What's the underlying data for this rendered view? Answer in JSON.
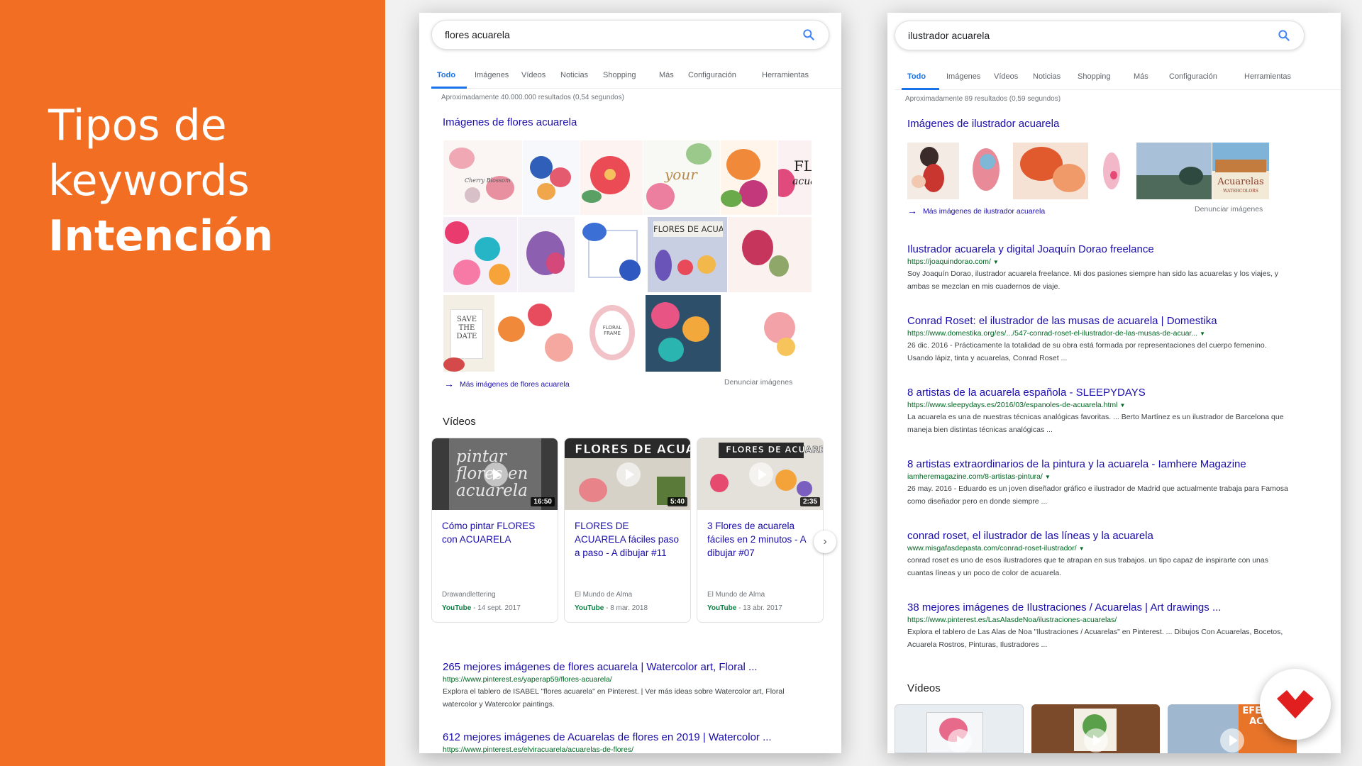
{
  "slide": {
    "title_line1": "Tipos de",
    "title_line2": "keywords",
    "title_line3": "Intención",
    "accent_color": "#f26e22"
  },
  "left_serp": {
    "query": "flores acuarela",
    "tabs": [
      "Todo",
      "Imágenes",
      "Vídeos",
      "Noticias",
      "Shopping",
      "Más",
      "Configuración",
      "Herramientas"
    ],
    "stats": "Aproximadamente 40.000.000 resultados (0,54 segundos)",
    "images_title": "Imágenes de flores acuarela",
    "image_texts": [
      "Cherry Blossom",
      "your",
      "FLO",
      "acuarela",
      "FLORES DE ACUARE",
      "SAVE THE DATE",
      "FLORAL FRAME"
    ],
    "more_images": "Más imágenes de flores acuarela",
    "report_images": "Denunciar imágenes",
    "videos_heading": "Vídeos",
    "videos": [
      {
        "title": "Cómo pintar FLORES con ACUARELA",
        "duration": "16:50",
        "channel": "Drawandlettering",
        "source": "YouTube",
        "date": "14 sept. 2017",
        "thumb_text": "pintar flores en acuarela"
      },
      {
        "title": "FLORES DE ACUARELA fáciles paso a paso - A dibujar #11",
        "duration": "5:40",
        "channel": "El Mundo de Alma",
        "source": "YouTube",
        "date": "8 mar. 2018",
        "thumb_text": "FLORES DE ACUARELA"
      },
      {
        "title": "3 Flores de acuarela fáciles en 2 minutos - A dibujar #07",
        "duration": "2:35",
        "channel": "El Mundo de Alma",
        "source": "YouTube",
        "date": "13 abr. 2017",
        "thumb_text": "FLORES DE ACUARELA"
      }
    ],
    "next_label": "›",
    "results": [
      {
        "title": "265 mejores imágenes de flores acuarela | Watercolor art, Floral ...",
        "url": "https://www.pinterest.es/yaperap59/flores-acuarela/",
        "snippet": "Explora el tablero de ISABEL \"flores acuarela\" en Pinterest. | Ver más ideas sobre Watercolor art, Floral watercolor y Watercolor paintings."
      },
      {
        "title": "612 mejores imágenes de Acuarelas de flores en 2019 | Watercolor ...",
        "url": "https://www.pinterest.es/elviracuarela/acuarelas-de-flores/",
        "snippet": ""
      }
    ]
  },
  "right_serp": {
    "query": "ilustrador acuarela",
    "tabs": [
      "Todo",
      "Imágenes",
      "Vídeos",
      "Noticias",
      "Shopping",
      "Más",
      "Configuración",
      "Herramientas"
    ],
    "stats": "Aproximadamente 89 resultados (0,59 segundos)",
    "images_title": "Imágenes de ilustrador acuarela",
    "image_texts": [
      "Acuarelas",
      "WATERCOLORS"
    ],
    "more_images": "Más imágenes de ilustrador acuarela",
    "report_images": "Denunciar imágenes",
    "results": [
      {
        "title": "Ilustrador acuarela y digital Joaquín Dorao freelance",
        "url": "https://joaquindorao.com/",
        "snippet": "Soy Joaquín Dorao, ilustrador acuarela freelance. Mi dos pasiones siempre han sido las acuarelas y los viajes, y ambas se mezclan en mis cuadernos de viaje."
      },
      {
        "title": "Conrad Roset: el ilustrador de las musas de acuarela | Domestika",
        "url": "https://www.domestika.org/es/.../547-conrad-roset-el-ilustrador-de-las-musas-de-acuar...",
        "snippet": "26 dic. 2016 - Prácticamente la totalidad de su obra está formada por representaciones del cuerpo femenino. Usando lápiz, tinta y acuarelas, Conrad Roset ..."
      },
      {
        "title": "8 artistas de la acuarela española - SLEEPYDAYS",
        "url": "https://www.sleepydays.es/2016/03/espanoles-de-acuarela.html",
        "snippet": "La acuarela es una de nuestras técnicas analógicas favoritas. ... Berto Martínez es un ilustrador de Barcelona que maneja bien distintas técnicas analógicas ..."
      },
      {
        "title": "8 artistas extraordinarios de la pintura y la acuarela - Iamhere Magazine",
        "url": "iamheremagazine.com/8-artistas-pintura/",
        "snippet": "26 may. 2016 - Eduardo es un joven diseñador gráfico e ilustrador de Madrid que actualmente trabaja para Famosa como diseñador pero en donde siempre ..."
      },
      {
        "title": "conrad roset, el ilustrador de las líneas y la acuarela",
        "url": "www.misgafasdepasta.com/conrad-roset-ilustrador/",
        "snippet": "conrad roset es uno de esos ilustradores que te atrapan en sus trabajos. un tipo capaz de inspirarte con unas cuantas líneas y un poco de color de acuarela."
      },
      {
        "title": "38 mejores imágenes de Ilustraciones / Acuarelas | Art drawings ...",
        "url": "https://www.pinterest.es/LasAlasdeNoa/ilustraciones-acuarelas/",
        "snippet": "Explora el tablero de Las Alas de Noa \"Ilustraciones / Acuarelas\" en Pinterest. ... Dibujos Con Acuarelas, Bocetos, Acuarela Rostros, Pinturas, Ilustradores ..."
      }
    ],
    "videos_heading": "Vídeos",
    "bottom_thumb_text": "EFECT DE ACUAR"
  }
}
